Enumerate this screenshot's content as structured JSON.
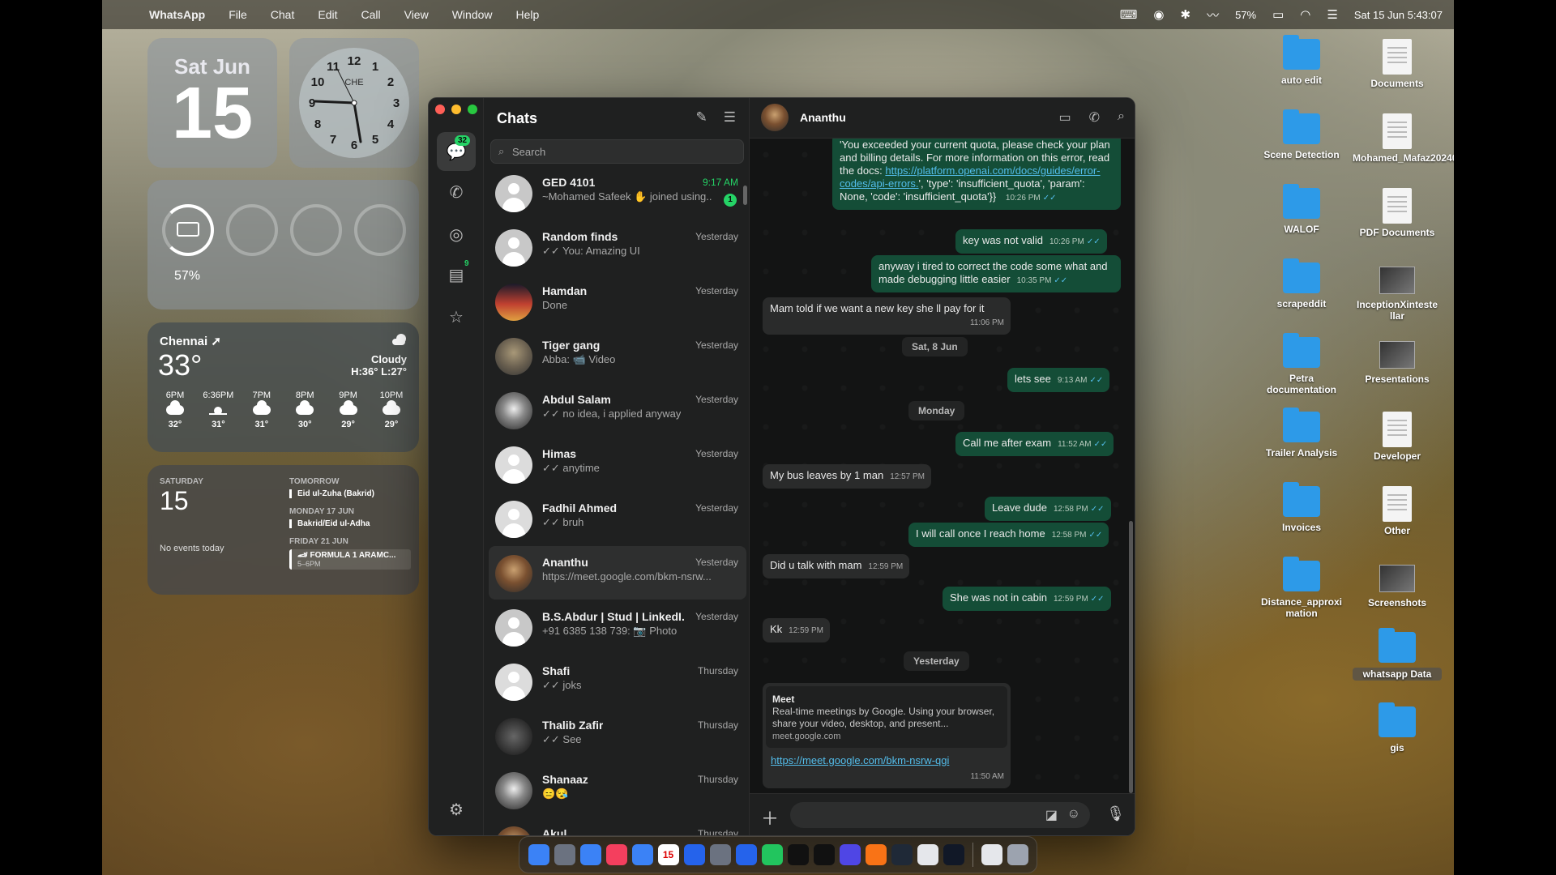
{
  "menubar": {
    "app_name": "WhatsApp",
    "items": [
      "File",
      "Chat",
      "Edit",
      "Call",
      "View",
      "Window",
      "Help"
    ],
    "battery": "57%",
    "datetime": "Sat 15 Jun  5:43:07"
  },
  "widgets": {
    "date": {
      "weekday_month": "Sat Jun",
      "day": "15"
    },
    "clock": {
      "city": "CHE",
      "numbers": [
        "12",
        "1",
        "2",
        "3",
        "4",
        "5",
        "6",
        "7",
        "8",
        "9",
        "10",
        "11"
      ]
    },
    "battery": {
      "percent": "57%",
      "level": 0.57
    },
    "weather": {
      "city": "Chennai ➚",
      "temp": "33°",
      "condition": "Cloudy",
      "hilo": "H:36° L:27°",
      "hourly": [
        {
          "time": "6PM",
          "icon": "cloud-icon",
          "temp": "32°"
        },
        {
          "time": "6:36PM",
          "icon": "sunset-icon",
          "temp": "31°"
        },
        {
          "time": "7PM",
          "icon": "cloud-icon",
          "temp": "31°"
        },
        {
          "time": "8PM",
          "icon": "cloud-icon",
          "temp": "30°"
        },
        {
          "time": "9PM",
          "icon": "cloud-icon",
          "temp": "29°"
        },
        {
          "time": "10PM",
          "icon": "cloud-icon",
          "temp": "29°"
        }
      ]
    },
    "calendar": {
      "weekday": "SATURDAY",
      "day": "15",
      "no_events": "No events today",
      "tomorrow_label": "TOMORROW",
      "tomorrow_event": "Eid ul-Zuha (Bakrid)",
      "monday_label": "MONDAY 17 JUN",
      "monday_event": "Bakrid/Eid ul-Adha",
      "friday_label": "FRIDAY 21 JUN",
      "friday_event": "🏎 FORMULA 1 ARAMC...",
      "friday_time": "5–6PM"
    }
  },
  "whatsapp": {
    "chats_title": "Chats",
    "rail_badge_chats": "32",
    "rail_badge_status": "9",
    "search_placeholder": "Search",
    "chats": [
      {
        "name": "GED 4101",
        "time": "9:17 AM",
        "preview": "~Mohamed Safeek ✋ joined using...",
        "unread": "1"
      },
      {
        "name": "Random finds",
        "time": "Yesterday",
        "preview": "✓✓ You: Amazing UI"
      },
      {
        "name": "Hamdan",
        "time": "Yesterday",
        "preview": "Done"
      },
      {
        "name": "Tiger gang",
        "time": "Yesterday",
        "preview": "Abba: 📹 Video"
      },
      {
        "name": "Abdul Salam",
        "time": "Yesterday",
        "preview": "✓✓ no idea, i applied anyway"
      },
      {
        "name": "Himas",
        "time": "Yesterday",
        "preview": "✓✓ anytime"
      },
      {
        "name": "Fadhil Ahmed",
        "time": "Yesterday",
        "preview": "✓✓ bruh"
      },
      {
        "name": "Ananthu",
        "time": "Yesterday",
        "preview": "https://meet.google.com/bkm-nsrw..."
      },
      {
        "name": "B.S.Abdur | Stud | LinkedI...",
        "time": "Yesterday",
        "preview": "+91 6385 138 739: 📷 Photo"
      },
      {
        "name": "Shafi",
        "time": "Thursday",
        "preview": "✓✓ joks"
      },
      {
        "name": "Thalib Zafir",
        "time": "Thursday",
        "preview": "✓✓ See"
      },
      {
        "name": "Shanaaz",
        "time": "Thursday",
        "preview": "😑😪"
      },
      {
        "name": "Akul",
        "time": "Thursday",
        "preview": ""
      }
    ],
    "conversation": {
      "contact": "Ananthu",
      "messages": {
        "m1_text": "'You exceeded your current quota, please check your plan and billing details. For more information on this error, read the docs: ",
        "m1_link": "https://platform.openai.com/docs/guides/error-codes/api-errors.",
        "m1_tail": "', 'type': 'insufficient_quota', 'param': None, 'code': 'insufficient_quota'}}",
        "m1_time": "10:26 PM",
        "m2_text": "key was not valid",
        "m2_time": "10:26 PM",
        "m3_text": "anyway i tired to correct the code some what and made debugging little easier",
        "m3_time": "10:35 PM",
        "m4_text": "Mam told if we want a new key she ll pay for it",
        "m4_time": "11:06 PM",
        "sep1": "Sat, 8 Jun",
        "m5_text": "lets see",
        "m5_time": "9:13 AM",
        "sep2": "Monday",
        "m6_text": "Call me after exam",
        "m6_time": "11:52 AM",
        "m7_text": "My bus leaves by 1 man",
        "m7_time": "12:57 PM",
        "m8_text": "Leave dude",
        "m8_time": "12:58 PM",
        "m9_text": "I will call once I reach home",
        "m9_time": "12:58 PM",
        "m10_text": "Did u talk with mam",
        "m10_time": "12:59 PM",
        "m11_text": "She was not in cabin",
        "m11_time": "12:59 PM",
        "m12_text": "Kk",
        "m12_time": "12:59 PM",
        "sep3": "Yesterday",
        "preview_title": "Meet",
        "preview_desc": "Real-time meetings by Google. Using your browser, share your video, desktop, and present...",
        "preview_domain": "meet.google.com",
        "m13_link": "https://meet.google.com/bkm-nsrw-qgi",
        "m13_time": "11:50 AM"
      }
    }
  },
  "desktop_icons": [
    {
      "label": "auto edit",
      "kind": "folder"
    },
    {
      "label": "Documents",
      "kind": "doc"
    },
    {
      "label": "Scene Detection",
      "kind": "folder"
    },
    {
      "label": "Mohamed_Mafaz2024041...amjt.jpg",
      "kind": "doc"
    },
    {
      "label": "WALOF",
      "kind": "folder"
    },
    {
      "label": "PDF Documents",
      "kind": "doc"
    },
    {
      "label": "scrapeddit",
      "kind": "folder"
    },
    {
      "label": "InceptionXinteste llar",
      "kind": "img"
    },
    {
      "label": "Petra documentation",
      "kind": "folder"
    },
    {
      "label": "Presentations",
      "kind": "img"
    },
    {
      "label": "Trailer Analysis",
      "kind": "folder"
    },
    {
      "label": "Developer",
      "kind": "doc"
    },
    {
      "label": "Invoices",
      "kind": "folder"
    },
    {
      "label": "Other",
      "kind": "doc"
    },
    {
      "label": "Distance_approxi mation",
      "kind": "folder"
    },
    {
      "label": "Screenshots",
      "kind": "img"
    },
    {
      "label": "whatsapp Data",
      "kind": "folder"
    },
    {
      "label": "gis",
      "kind": "folder"
    }
  ],
  "dock": [
    "finder-icon",
    "launchpad-icon",
    "safari-icon",
    "music-icon",
    "mail-icon",
    "calendar-icon",
    "app-store-icon",
    "settings-icon",
    "vscode-icon",
    "whatsapp-icon",
    "tv-icon",
    "netflix-icon",
    "prime-icon",
    "vlc-icon",
    "terminal-icon",
    "notes-icon",
    "activity-icon",
    "file-icon",
    "trash-icon"
  ],
  "dock_calendar_day": "15"
}
